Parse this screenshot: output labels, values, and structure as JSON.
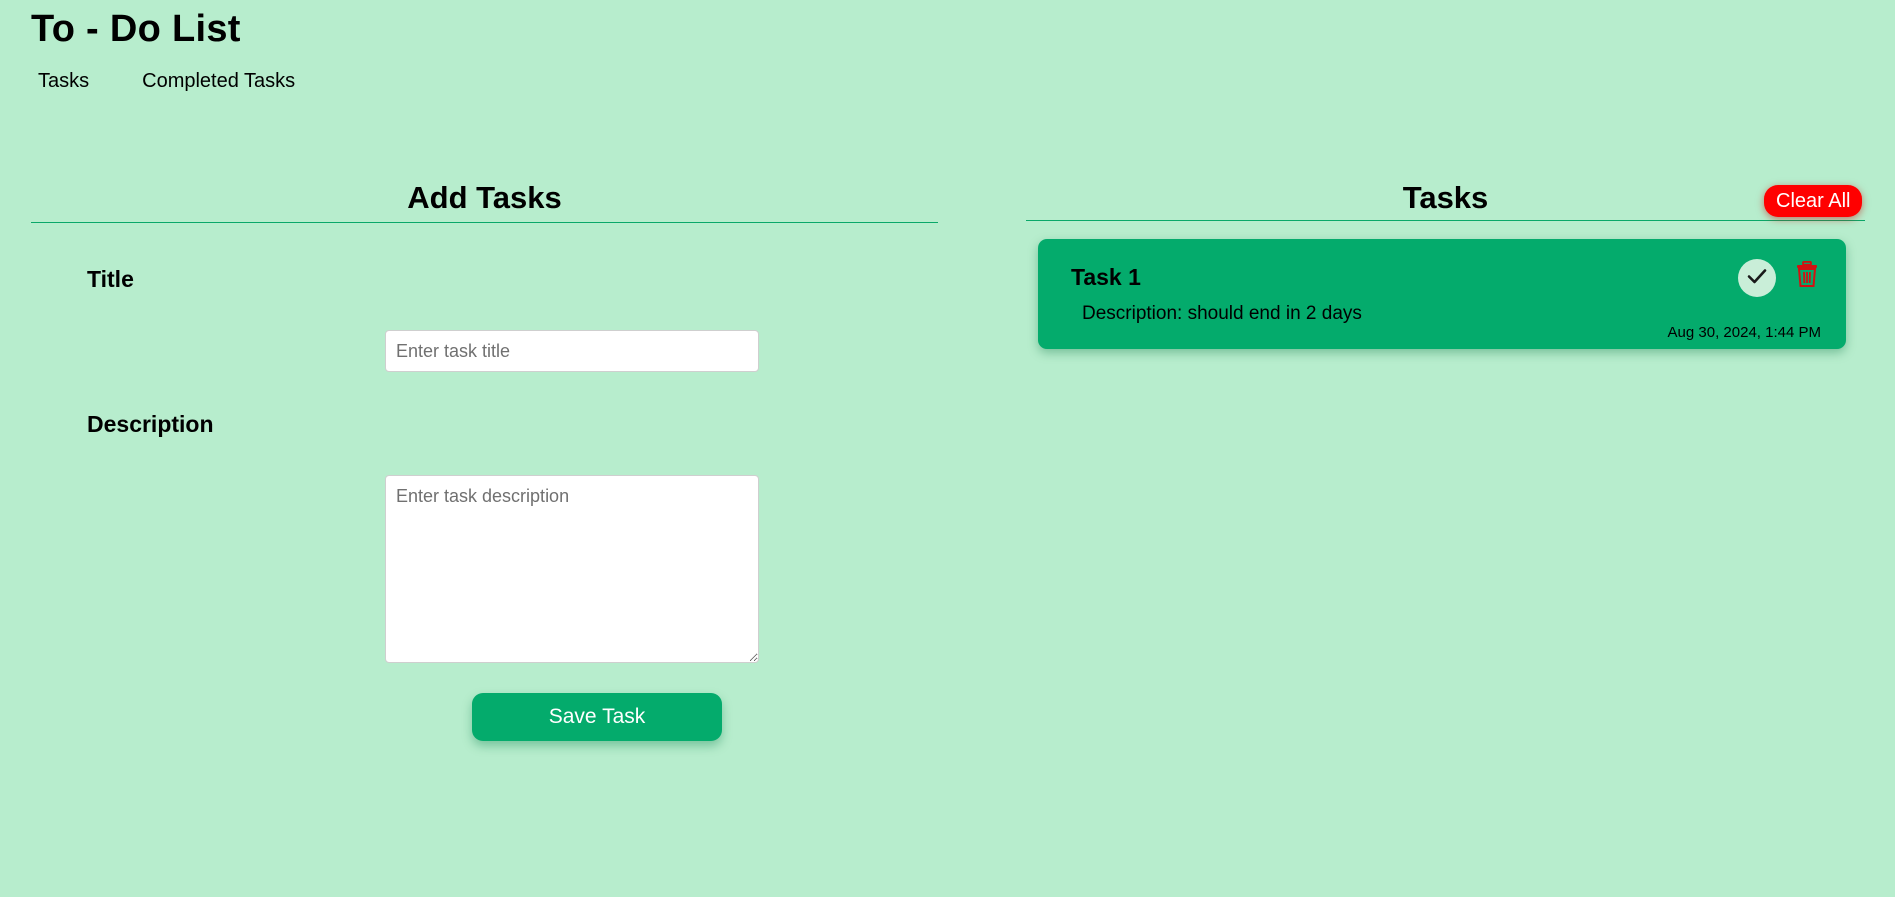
{
  "app": {
    "title": "To - Do List"
  },
  "nav": {
    "tasks": "Tasks",
    "completed": "Completed Tasks"
  },
  "add_panel": {
    "heading": "Add Tasks",
    "title_label": "Title",
    "title_placeholder": "Enter task title",
    "title_value": "",
    "description_label": "Description",
    "description_placeholder": "Enter task description",
    "description_value": "",
    "save_label": "Save Task"
  },
  "tasks_panel": {
    "heading": "Tasks",
    "clear_label": "Clear All",
    "tasks": [
      {
        "title": "Task 1",
        "description": "Description: should end in 2 days",
        "date": "Aug 30, 2024, 1:44 PM",
        "complete_icon": "check-icon",
        "delete_icon": "trash-icon"
      }
    ]
  },
  "colors": {
    "background": "#b7edcd",
    "accent": "#04ab6c",
    "danger": "#ff0000",
    "delete_icon": "#d11212"
  }
}
